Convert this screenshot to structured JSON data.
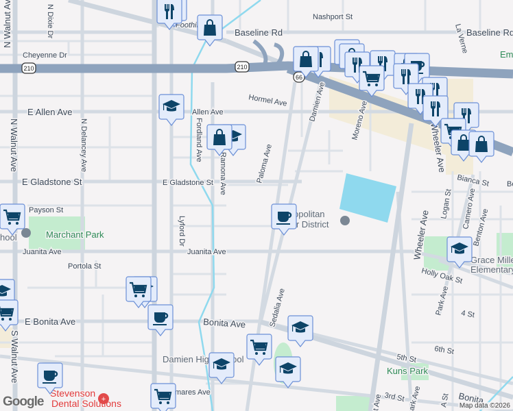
{
  "map": {
    "streets": {
      "nashport": "Nashport St",
      "baseline_e": "Baseline Rd",
      "baseline_w": "Baseline Rd",
      "foothill": "Foothil",
      "la_verne": "La Verne",
      "cheyenne": "Cheyenne Dr",
      "n_dixie": "N Dixie Dr",
      "n_walnut_top": "N Walnut Ave",
      "n_walnut_mid": "N Walnut Ave",
      "s_walnut": "S Walnut Ave",
      "e_allen": "E Allen Ave",
      "allen": "Allen Ave",
      "hormel": "Hormel Ave",
      "damien": "Damien Ave",
      "moreno": "Moreno Ave",
      "n_delancey": "N Delancey Ave",
      "fordland": "Fordland Ave",
      "ramona": "Ramona Ave",
      "paloma": "Paloma Ave",
      "e_gladstone_w": "E Gladstone St",
      "e_gladstone_e": "E Gladstone St",
      "payson": "Payson St",
      "lyford": "Lyford Dr",
      "juanita_w": "Juanita Ave",
      "juanita_e": "Juanita Ave",
      "portola": "Portola St",
      "e_bonita": "E Bonita Ave",
      "bonita": "Bonita Ave",
      "bonita_se": "Bonita",
      "sedalia": "Sedalia Ave",
      "wheeler": "Wheeler Ave",
      "bianca": "Bianca St",
      "logan": "Logan St",
      "camero": "Camero Ave",
      "benton": "Benton Ave",
      "holly_oak": "Holly Oak St",
      "park_ave": "Park Ave",
      "a_st": "A St",
      "fourth": "4 St",
      "sixth": "6th St",
      "fifth": "5th St",
      "third": "3rd St",
      "ark_ave": "ark Ave",
      "st_ave": "t Ave",
      "a_st2": "A St",
      "mares": "mares Ave",
      "be": "Be"
    },
    "highways": {
      "i210": "210",
      "r66": "66"
    },
    "places": {
      "marchant_park": "Marchant Park",
      "kuns_park": "Kuns Park",
      "metro_water_1": "Metropolitan",
      "metro_water_2": "Water District",
      "grace_miller_1": "Grace Miller",
      "grace_miller_2": "Elementary",
      "damien_hs": "Damien High School",
      "stevenson_1": "Stevenson",
      "stevenson_2": "Dental Solutions",
      "em": "Em",
      "school_w": "hool"
    },
    "colors": {
      "marker_fill": "#e4ecfb",
      "marker_border": "#6b8fd6",
      "marker_icon": "#0d4468",
      "park": "#c4eccf",
      "water": "#8fd9ee",
      "commercial": "#f3ecd9"
    },
    "markers": [
      "restaurant",
      "restaurant",
      "shopping",
      "education",
      "education",
      "shopping",
      "restaurant",
      "shopping",
      "shopping",
      "shopping",
      "restaurant",
      "restaurant",
      "shopping",
      "cafe",
      "grocery",
      "restaurant",
      "restaurant",
      "restaurant",
      "restaurant",
      "restaurant",
      "grocery",
      "shopping",
      "shopping",
      "cafe",
      "education",
      "education",
      "grocery",
      "cafe",
      "education",
      "grocery",
      "education",
      "education",
      "cafe",
      "grocery",
      "grocery",
      "education",
      "grocery",
      "parking"
    ]
  },
  "attribution": {
    "logo": "Google",
    "text": "Map data ©2026"
  }
}
